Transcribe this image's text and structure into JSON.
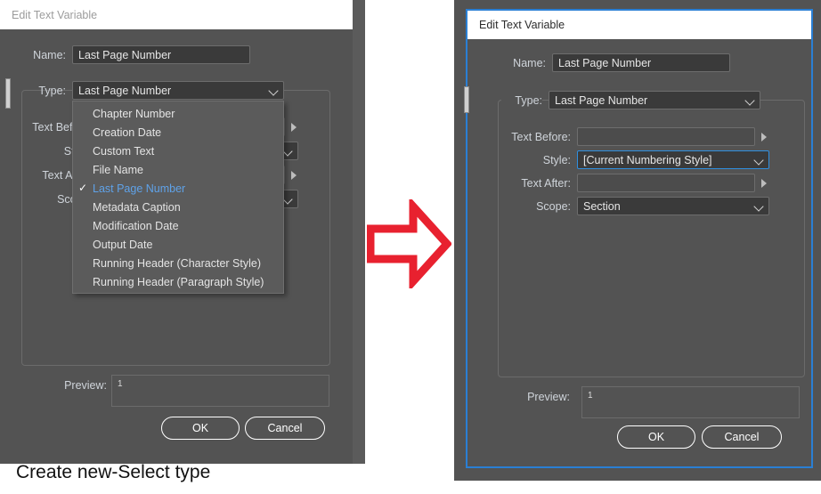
{
  "caption": "Create new-Select type",
  "colors": {
    "dialog_bg": "#535353",
    "accent_blue": "#2a7fd4",
    "selected_item": "#5fa2e8",
    "arrow_red": "#e8212f",
    "title_bar": "#ffffff"
  },
  "left_dialog": {
    "title": "Edit Text Variable",
    "name_label": "Name:",
    "name_value": "Last Page Number",
    "type_label": "Type:",
    "type_value": "Last Page Number",
    "text_before_label": "Text Before:",
    "text_after_label": "Text After:",
    "style_label": "Style:",
    "scope_label": "Scope:",
    "preview_label": "Preview:",
    "preview_value": "1",
    "ok_label": "OK",
    "cancel_label": "Cancel",
    "type_menu": {
      "selected": "Last Page Number",
      "items": [
        "Chapter Number",
        "Creation Date",
        "Custom Text",
        "File Name",
        "Last Page Number",
        "Metadata Caption",
        "Modification Date",
        "Output Date",
        "Running Header (Character Style)",
        "Running Header (Paragraph Style)"
      ]
    }
  },
  "right_dialog": {
    "title": "Edit Text Variable",
    "name_label": "Name:",
    "name_value": "Last Page Number",
    "type_label": "Type:",
    "type_value": "Last Page Number",
    "text_before_label": "Text Before:",
    "text_before_value": "",
    "style_label": "Style:",
    "style_value": "[Current Numbering Style]",
    "text_after_label": "Text After:",
    "text_after_value": "",
    "scope_label": "Scope:",
    "scope_value": "Section",
    "preview_label": "Preview:",
    "preview_value": "1",
    "ok_label": "OK",
    "cancel_label": "Cancel"
  }
}
